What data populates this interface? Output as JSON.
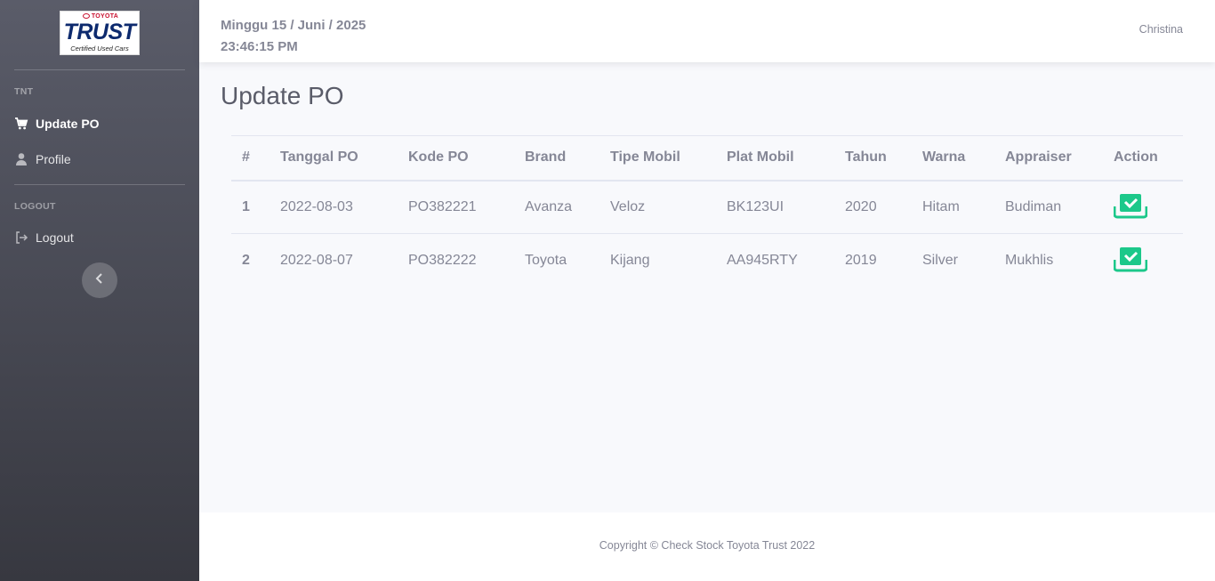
{
  "brand": {
    "maker": "TOYOTA",
    "name": "TRUST",
    "tagline": "Certified Used Cars"
  },
  "sidebar": {
    "section_1": "TNT",
    "items": [
      {
        "label": "Update PO",
        "icon": "cart-icon"
      },
      {
        "label": "Profile",
        "icon": "user-icon"
      }
    ],
    "section_2": "LOGOUT",
    "logout_label": "Logout",
    "toggle_icon": "chevron-left-icon"
  },
  "topbar": {
    "date": "Minggu 15 / Juni / 2025",
    "time": "23:46:15 PM",
    "user": "Christina"
  },
  "main": {
    "title": "Update PO",
    "columns": [
      "#",
      "Tanggal PO",
      "Kode PO",
      "Brand",
      "Tipe Mobil",
      "Plat Mobil",
      "Tahun",
      "Warna",
      "Appraiser",
      "Action"
    ],
    "rows": [
      [
        "1",
        "2022-08-03",
        "PO382221",
        "Avanza",
        "Veloz",
        "BK123UI",
        "2020",
        "Hitam",
        "Budiman"
      ],
      [
        "2",
        "2022-08-07",
        "PO382222",
        "Toyota",
        "Kijang",
        "AA945RTY",
        "2019",
        "Silver",
        "Mukhlis"
      ]
    ],
    "action_icon": "check-download-icon",
    "action_color": "#1cc88a"
  },
  "footer": {
    "copyright": "Copyright © Check Stock Toyota Trust 2022"
  }
}
